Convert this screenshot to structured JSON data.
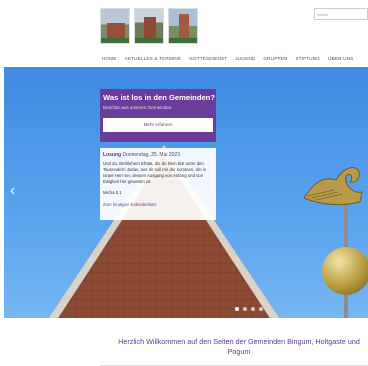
{
  "logos": [
    {
      "name": "Bingum",
      "icon": "church-photo-1"
    },
    {
      "name": "Holtgaste",
      "icon": "church-photo-2"
    },
    {
      "name": "Pogum",
      "icon": "church-photo-3"
    }
  ],
  "search": {
    "placeholder": "Suche"
  },
  "nav": {
    "items": [
      "HOME",
      "AKTUELLES & TERMINE",
      "GOTTESDIENST",
      "JUGEND",
      "GRUPPEN",
      "STIFTUNG",
      "ÜBER UNS"
    ]
  },
  "hero": {
    "prev_icon": "chevron-left-icon",
    "slides_count": 4,
    "active_slide": 1
  },
  "promo": {
    "title": "Was ist los in den Gemeinden?",
    "subtitle": "Berichte aus unseren Gemeinden",
    "button": "Mehr erfahren"
  },
  "losung": {
    "label": "Losung",
    "date": "Donnerstag, 25. Mai 2023",
    "text": "Und du, Bethlehem Efrata, die du klein bist unter den Tausendern Judas, aus dir soll mir der kommen, der in Israel Herr sei, dessen Ausgang von Anfang und von Ewigkeit her gewesen ist.",
    "reference": "Micha 5,1",
    "link": "Zum heutigen Kalenderblatt"
  },
  "welcome": {
    "text": "Herzlich Willkommen auf den Seiten der Gemeinden Bingum, Holtgaste und Pogum"
  },
  "colors": {
    "accent": "#6a3d9a",
    "sky": "#4a94e6",
    "brick": "#8b4a33"
  }
}
